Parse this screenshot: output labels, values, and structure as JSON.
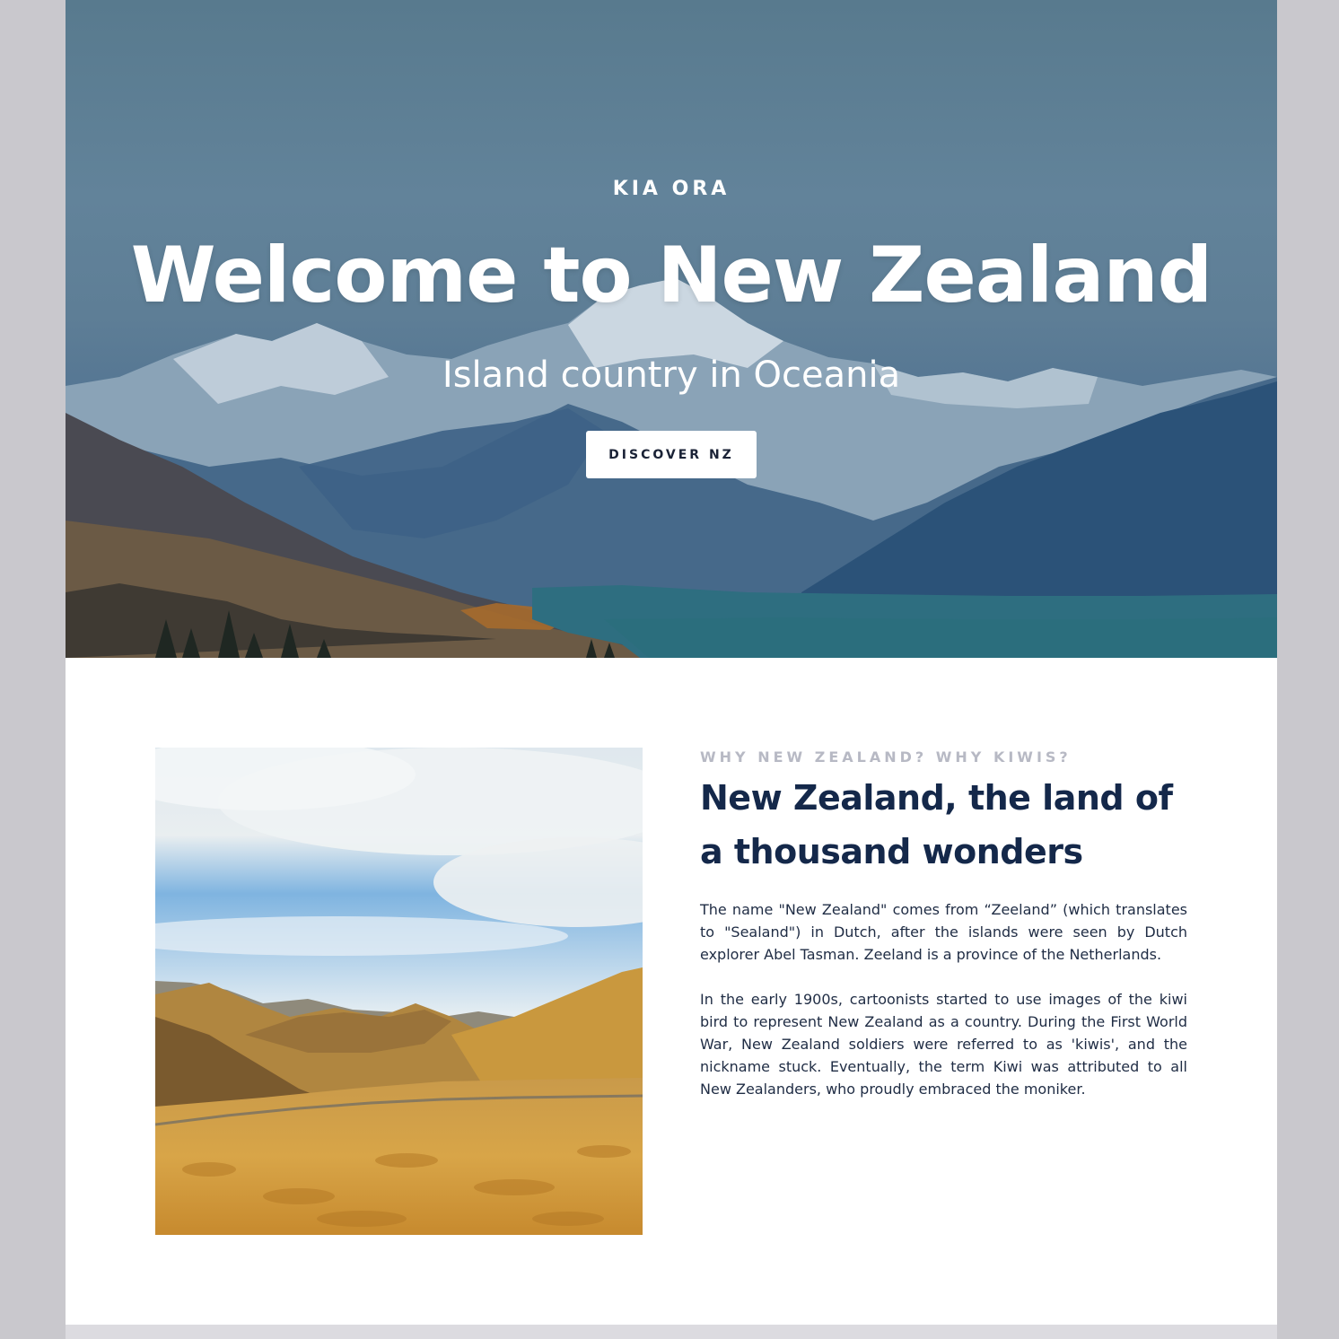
{
  "hero": {
    "kicker": "KIA ORA",
    "title": "Welcome to New Zealand",
    "subtitle": "Island country in Oceania",
    "cta_label": "DISCOVER NZ"
  },
  "about": {
    "eyebrow": "WHY NEW ZEALAND? WHY KIWIS?",
    "heading": "New Zealand, the land of a thousand wonders",
    "paragraphs": [
      "The name \"New Zealand\" comes from “Zeeland” (which translates to \"Sealand\") in Dutch, after the islands were seen by Dutch explorer Abel Tasman. Zeeland is a province of the Netherlands.",
      "In the early 1900s, cartoonists started to use images of the kiwi bird to represent New Zealand as a country. During the First World War, New Zealand soldiers were referred to as 'kiwis', and the nickname stuck. Eventually, the term Kiwi was attributed to all New Zealanders, who proudly embraced the moniker."
    ]
  },
  "colors": {
    "page_background": "#c9c8cd",
    "heading": "#14284a",
    "body_text": "#1f2c44",
    "eyebrow": "#b7b9c4",
    "button_bg": "#ffffff",
    "button_text": "#1a2236"
  }
}
